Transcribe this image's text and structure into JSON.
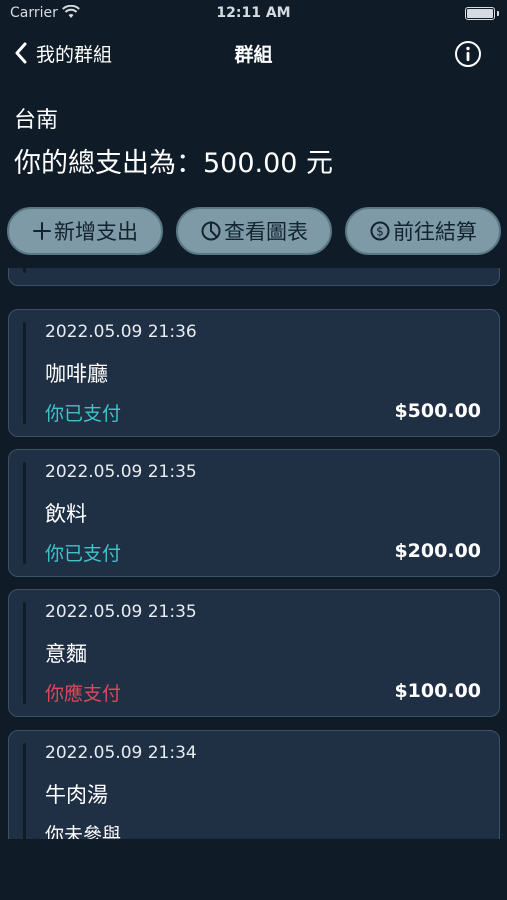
{
  "status_bar": {
    "carrier": "Carrier",
    "time": "12:11 AM"
  },
  "nav": {
    "back_label": "我的群組",
    "title": "群組"
  },
  "group": {
    "name": "台南",
    "total_text": "你的總支出為：500.00 元"
  },
  "actions": [
    {
      "label": "新增支出",
      "icon": "plus-icon"
    },
    {
      "label": "查看圖表",
      "icon": "pie-chart-icon"
    },
    {
      "label": "前往結算",
      "icon": "dollar-circle-icon"
    }
  ],
  "expenses": [
    {
      "timestamp": "2022.05.09 21:36",
      "name": "咖啡廳",
      "status": "你已支付",
      "status_type": "paid",
      "amount": "$500.00"
    },
    {
      "timestamp": "2022.05.09 21:35",
      "name": "飲料",
      "status": "你已支付",
      "status_type": "paid",
      "amount": "$200.00"
    },
    {
      "timestamp": "2022.05.09 21:35",
      "name": "意麵",
      "status": "你應支付",
      "status_type": "owe",
      "amount": "$100.00"
    },
    {
      "timestamp": "2022.05.09 21:34",
      "name": "牛肉湯",
      "status": "你未參與",
      "status_type": "none",
      "amount": ""
    }
  ],
  "colors": {
    "background": "#0f1c28",
    "card": "#1f2f44",
    "button": "#7d9aa6",
    "paid": "#3fc3c8",
    "owe": "#e0475d"
  }
}
